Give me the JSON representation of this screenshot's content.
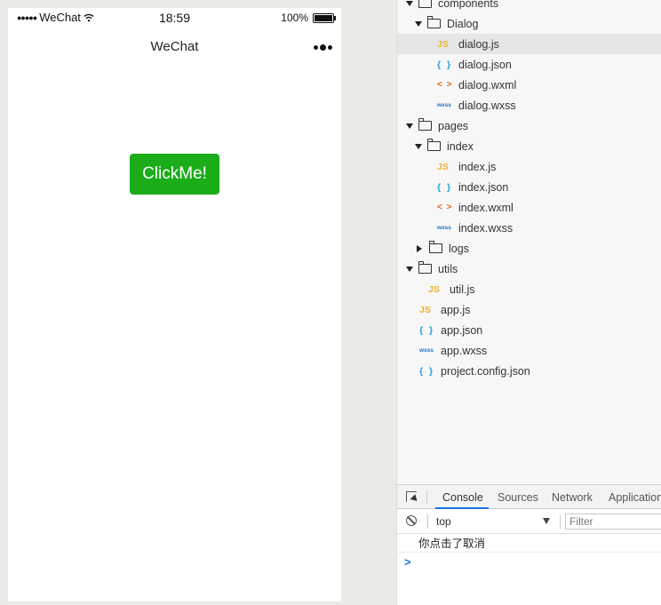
{
  "simulator": {
    "status_bar": {
      "signal": "●●●●●",
      "carrier": "WeChat",
      "time": "18:59",
      "battery": "100%"
    },
    "nav_bar": {
      "title": "WeChat"
    },
    "button_label": "ClickMe!",
    "button_color": "#1aad19"
  },
  "file_tree": [
    {
      "label": "components",
      "kind": "folder",
      "expanded": true,
      "depth": 0
    },
    {
      "label": "Dialog",
      "kind": "folder",
      "expanded": true,
      "depth": 1
    },
    {
      "label": "dialog.js",
      "kind": "js",
      "icon": "JS",
      "depth": 2,
      "selected": true
    },
    {
      "label": "dialog.json",
      "kind": "json",
      "icon": "{ }",
      "depth": 2
    },
    {
      "label": "dialog.wxml",
      "kind": "wxml",
      "icon": "< >",
      "depth": 2
    },
    {
      "label": "dialog.wxss",
      "kind": "wxss",
      "icon": "wxss",
      "depth": 2
    },
    {
      "label": "pages",
      "kind": "folder",
      "expanded": true,
      "depth": 0
    },
    {
      "label": "index",
      "kind": "folder",
      "expanded": true,
      "depth": 1
    },
    {
      "label": "index.js",
      "kind": "js",
      "icon": "JS",
      "depth": 2
    },
    {
      "label": "index.json",
      "kind": "json",
      "icon": "{ }",
      "depth": 2
    },
    {
      "label": "index.wxml",
      "kind": "wxml",
      "icon": "< >",
      "depth": 2
    },
    {
      "label": "index.wxss",
      "kind": "wxss",
      "icon": "wxss",
      "depth": 2
    },
    {
      "label": "logs",
      "kind": "folder",
      "expanded": false,
      "depth": 1
    },
    {
      "label": "utils",
      "kind": "folder",
      "expanded": true,
      "depth": 0
    },
    {
      "label": "util.js",
      "kind": "js",
      "icon": "JS",
      "depth": 1
    },
    {
      "label": "app.js",
      "kind": "js",
      "icon": "JS",
      "depth": 0
    },
    {
      "label": "app.json",
      "kind": "json",
      "icon": "{ }",
      "depth": 0
    },
    {
      "label": "app.wxss",
      "kind": "wxss",
      "icon": "wxss",
      "depth": 0
    },
    {
      "label": "project.config.json",
      "kind": "json",
      "icon": "{ }",
      "depth": 0
    }
  ],
  "devtools": {
    "tabs": [
      "Console",
      "Sources",
      "Network",
      "Application"
    ],
    "active_tab": "Console",
    "context": "top",
    "filter_placeholder": "Filter",
    "log_message": "你点击了取消",
    "prompt": ">"
  }
}
